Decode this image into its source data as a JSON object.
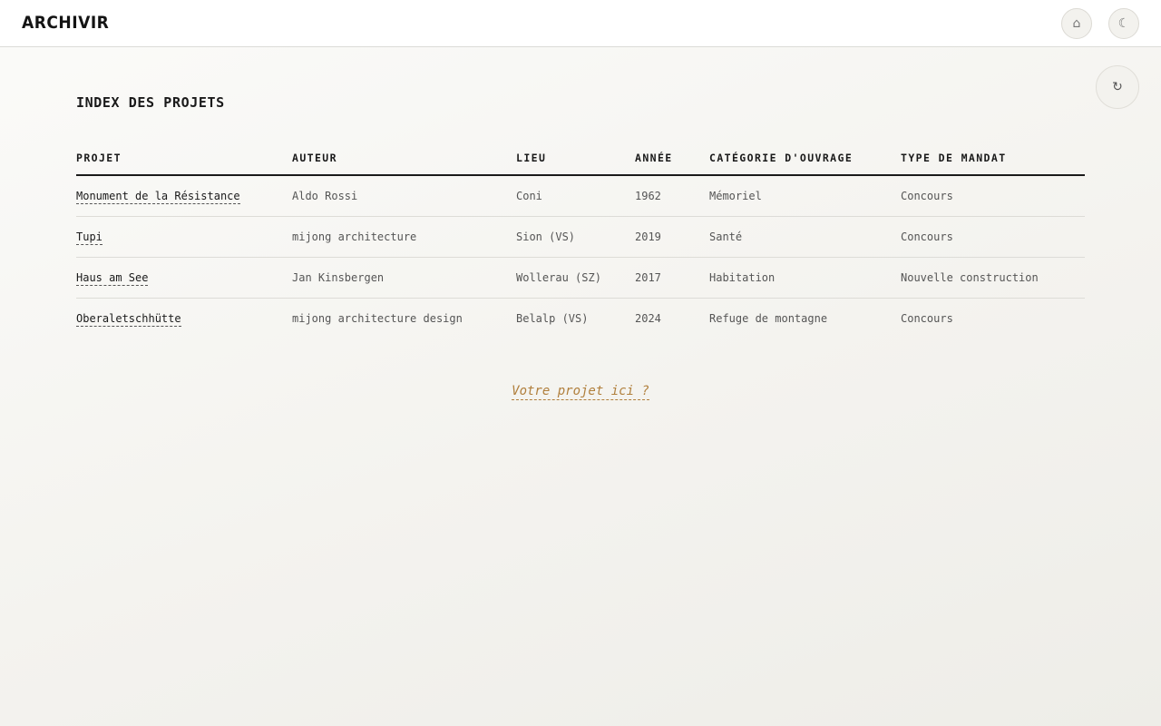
{
  "header": {
    "logo": "ARCHIVIR",
    "home_icon": "home-icon",
    "theme_icon": "moon-icon",
    "home_glyph": "⌂",
    "theme_glyph": "☾"
  },
  "refresh": {
    "icon": "refresh-icon",
    "glyph": "↻"
  },
  "page": {
    "title": "INDEX DES PROJETS"
  },
  "table": {
    "columns": [
      "PROJET",
      "AUTEUR",
      "LIEU",
      "ANNÉE",
      "CATÉGORIE D'OUVRAGE",
      "TYPE DE MANDAT"
    ],
    "rows": [
      [
        "Monument de la Résistance",
        "Aldo Rossi",
        "Coni",
        "1962",
        "Mémoriel",
        "Concours"
      ],
      [
        "Tupi",
        "mijong architecture",
        "Sion (VS)",
        "2019",
        "Santé",
        "Concours"
      ],
      [
        "Haus am See",
        "Jan Kinsbergen",
        "Wollerau (SZ)",
        "2017",
        "Habitation",
        "Nouvelle construction"
      ],
      [
        "Oberaletschhütte",
        "mijong architecture design",
        "Belalp (VS)",
        "2024",
        "Refuge de montagne",
        "Concours"
      ]
    ]
  },
  "cta": {
    "label": "Votre projet ici ?"
  },
  "colors": {
    "accent": "#b07f3c",
    "text": "#1a1a1a",
    "muted": "#555555"
  }
}
